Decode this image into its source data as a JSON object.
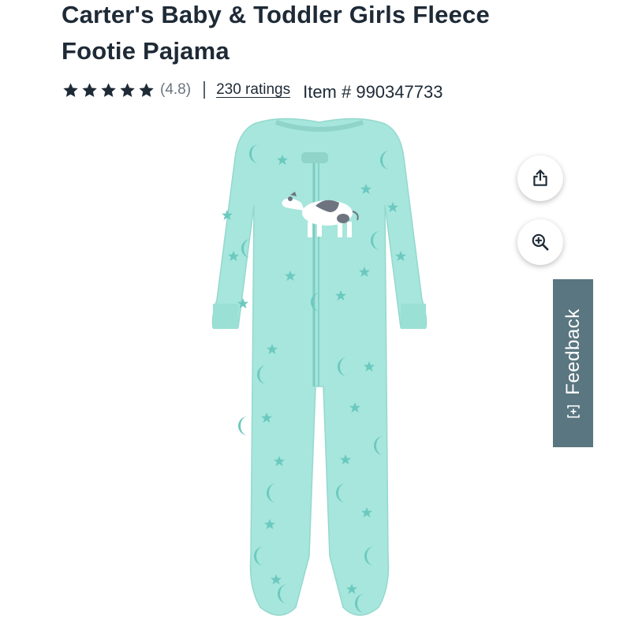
{
  "product": {
    "title_line1": "Carter's Baby & Toddler Girls Fleece",
    "title_line2": "Footie Pajama",
    "rating_value": "(4.8)",
    "ratings_link": "230 ratings",
    "item_number": "Item # 990347733",
    "stars": 5,
    "star_color": "#1e2a36"
  },
  "image": {
    "description_icon": "footie-pajama-image",
    "fabric_color": "#a6e6dc",
    "pattern_color": "#6cc9bf"
  },
  "actions": {
    "share_icon": "share-icon",
    "zoom_icon": "zoom-in-icon"
  },
  "feedback": {
    "label": "Feedback",
    "icon": "feedback-plus-icon",
    "color": "#5a7680"
  }
}
